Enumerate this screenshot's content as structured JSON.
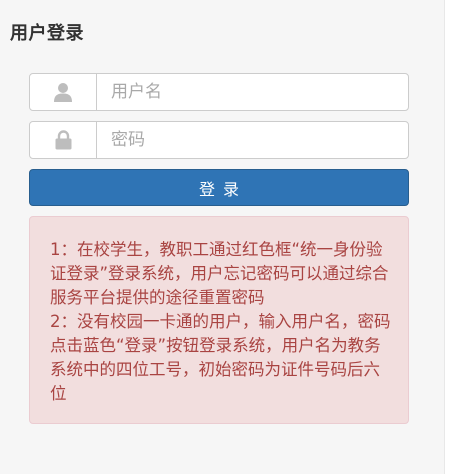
{
  "header": {
    "title": "用户登录"
  },
  "login_form": {
    "username": {
      "icon": "user-icon",
      "placeholder": "用户名",
      "value": ""
    },
    "password": {
      "icon": "lock-icon",
      "placeholder": "密码",
      "value": ""
    },
    "submit_label": "登录"
  },
  "notice": {
    "line1": "1：在校学生，教职工通过红色框“统一身份验证登录”登录系统，用户忘记密码可以通过综合服务平台提供的途径重置密码",
    "line2": "2：没有校园一卡通的用户，输入用户名，密码点击蓝色“登录”按钮登录系统，用户名为教务系统中的四位工号，初始密码为证件号码后六位"
  },
  "colors": {
    "primary_button": "#2f74b5",
    "alert_background": "#f2dede",
    "alert_text": "#a94442"
  }
}
